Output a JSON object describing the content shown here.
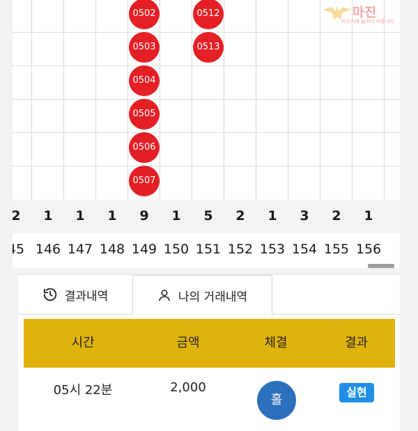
{
  "road": {
    "columns": [
      {
        "index": "45",
        "count": "2",
        "balls": []
      },
      {
        "index": "146",
        "count": "1",
        "balls": []
      },
      {
        "index": "147",
        "count": "1",
        "balls": []
      },
      {
        "index": "148",
        "count": "1",
        "balls": []
      },
      {
        "index": "149",
        "count": "9",
        "balls": [
          "0502",
          "0503",
          "0504",
          "0505",
          "0506",
          "0507"
        ]
      },
      {
        "index": "150",
        "count": "1",
        "balls": []
      },
      {
        "index": "151",
        "count": "5",
        "balls": [
          "0512",
          "0513"
        ]
      },
      {
        "index": "152",
        "count": "2",
        "balls": []
      },
      {
        "index": "153",
        "count": "1",
        "balls": []
      },
      {
        "index": "154",
        "count": "3",
        "balls": []
      },
      {
        "index": "155",
        "count": "2",
        "balls": []
      },
      {
        "index": "156",
        "count": "1",
        "balls": []
      }
    ],
    "ball_color": "#e41f25"
  },
  "watermark": {
    "title": "마진",
    "subtitle": "마진거래 놀이터 커뮤니티"
  },
  "tabs": {
    "history_label": "결과내역",
    "history_icon": "history-clock-icon",
    "my_trades_label": "나의 거래내역",
    "my_trades_icon": "user-icon"
  },
  "table": {
    "header_color": "#e0b30c",
    "headers": {
      "time": "시간",
      "amount": "금액",
      "fill": "체결",
      "result": "결과"
    },
    "rows": [
      {
        "time": "05시 22분",
        "amount": "2,000",
        "fill": "홀",
        "fill_color": "#2c6fbd",
        "result": "실현",
        "result_color": "#1f8fe6"
      }
    ]
  }
}
